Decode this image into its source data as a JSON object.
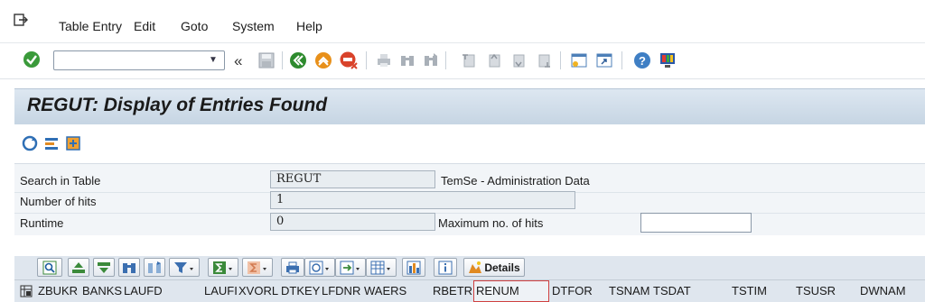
{
  "menu": {
    "items": [
      {
        "label": "Table Entry"
      },
      {
        "label": "Edit"
      },
      {
        "label": "Goto"
      },
      {
        "label": "System"
      },
      {
        "label": "Help"
      }
    ]
  },
  "toolbar": {
    "command_value": "",
    "back_label": "«"
  },
  "title": "REGUT: Display of Entries Found",
  "form": {
    "search_label": "Search in Table",
    "search_value": "REGUT",
    "search_desc": "TemSe - Administration Data",
    "hits_label": "Number of hits",
    "hits_value": "1",
    "runtime_label": "Runtime",
    "runtime_value": "0",
    "max_hits_label": "Maximum no. of hits",
    "max_hits_value": ""
  },
  "alv": {
    "details_label": "Details"
  },
  "columns": [
    "ZBUKR",
    "BANKS",
    "LAUFD",
    "LAUFI",
    "XVORL",
    "DTKEY",
    "LFDNR",
    "WAERS",
    "RBETR",
    "RENUM",
    "DTFOR",
    "TSNAM",
    "TSDAT",
    "TSTIM",
    "TSUSR",
    "DWNAM"
  ],
  "colors": {
    "ok_green": "#3a9a3a",
    "back_green": "#2e8b2e",
    "exit_orange": "#e8901a",
    "cancel_red": "#d9432b",
    "title_band": "#c6d5e3",
    "selection_border": "#d04040"
  }
}
